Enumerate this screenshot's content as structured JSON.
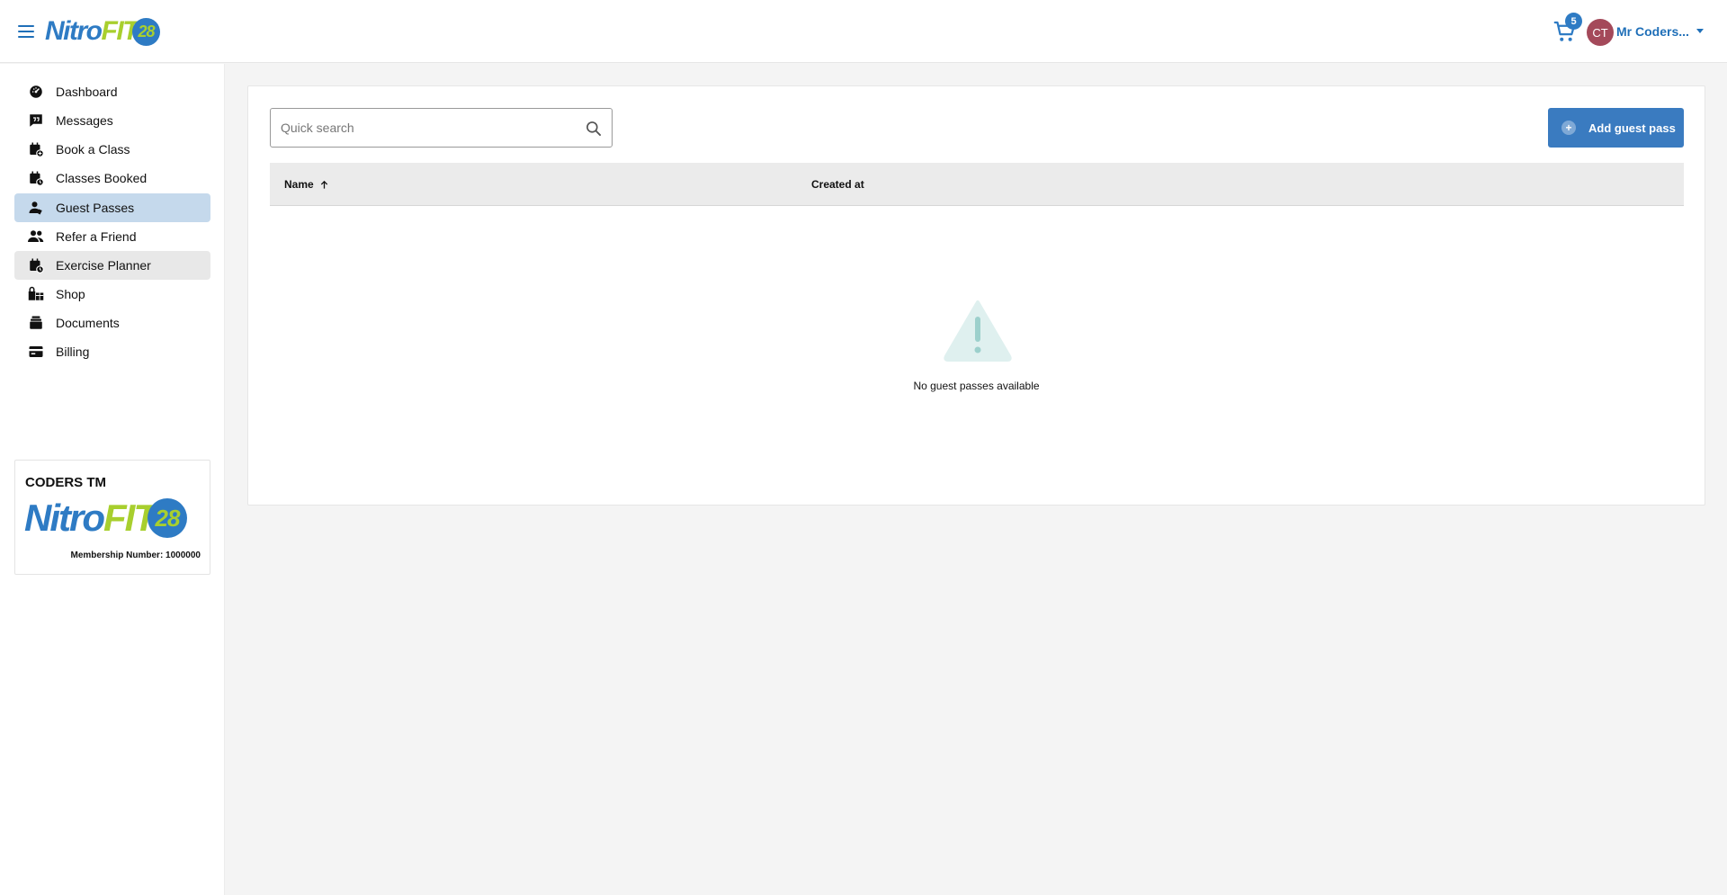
{
  "header": {
    "logo": {
      "part1": "Nitro",
      "part2": "FIT",
      "part3": "28"
    },
    "cart_count": "5",
    "avatar_initials": "CT",
    "user_name": "Mr Coders..."
  },
  "sidebar": {
    "items": [
      {
        "label": "Dashboard",
        "icon": "dashboard-icon"
      },
      {
        "label": "Messages",
        "icon": "message-icon"
      },
      {
        "label": "Book a Class",
        "icon": "calendar-add-icon"
      },
      {
        "label": "Classes Booked",
        "icon": "calendar-clock-icon"
      },
      {
        "label": "Guest Passes",
        "icon": "guest-icon",
        "active": true
      },
      {
        "label": "Refer a Friend",
        "icon": "people-icon"
      },
      {
        "label": "Exercise Planner",
        "icon": "calendar-planner-icon",
        "hover": true
      },
      {
        "label": "Shop",
        "icon": "shop-icon"
      },
      {
        "label": "Documents",
        "icon": "documents-icon"
      },
      {
        "label": "Billing",
        "icon": "billing-icon"
      }
    ],
    "card": {
      "title": "CODERS TM",
      "logo": {
        "part1": "Nitro",
        "part2": "FIT",
        "part3": "28"
      },
      "membership": "Membership Number: 1000000"
    }
  },
  "main": {
    "search": {
      "placeholder": "Quick search",
      "value": ""
    },
    "add_button_label": "Add guest pass",
    "table": {
      "columns": [
        "Name",
        "Created at"
      ],
      "rows": []
    },
    "empty_message": "No guest passes available"
  },
  "colors": {
    "brand_blue": "#2e7bc4",
    "brand_green": "#a8cf2e",
    "active_item": "#c5d9ec",
    "button": "#3a7bc0",
    "avatar": "#a4495a"
  }
}
